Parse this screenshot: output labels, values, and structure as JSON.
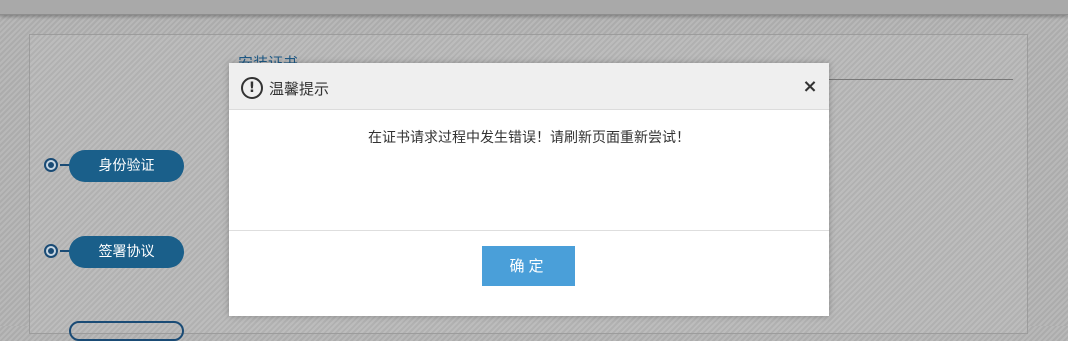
{
  "page": {
    "section_title": "安装证书"
  },
  "steps": [
    {
      "label": "身份验证"
    },
    {
      "label": "签署协议"
    }
  ],
  "dialog": {
    "title": "温馨提示",
    "icon": "exclamation-circle-icon",
    "close_symbol": "×",
    "message": "在证书请求过程中发生错误！请刷新页面重新尝试！",
    "confirm_label": "确定"
  },
  "colors": {
    "step_pill": "#1a5f8a",
    "confirm_button": "#4a9fd9",
    "section_title": "#1f5a86"
  }
}
